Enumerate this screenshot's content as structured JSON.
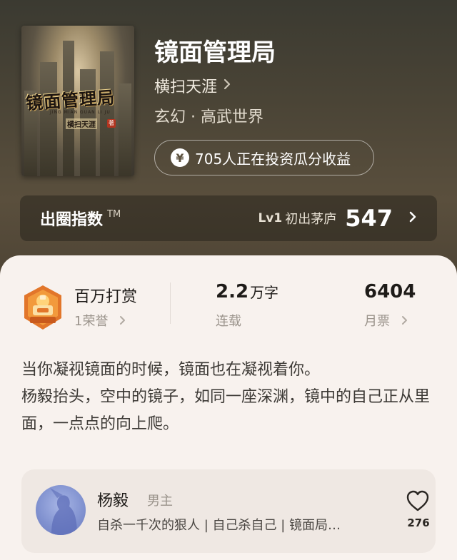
{
  "book": {
    "title": "镜面管理局",
    "author": "横扫天涯",
    "genre": "玄幻 · 高武世界",
    "invest_text": "705人正在投资瓜分收益",
    "cover": {
      "title": "镜面管理局",
      "pinyin": "JING MIAN GUAN LI JU",
      "author": "横扫天涯",
      "badge": "著"
    }
  },
  "index_bar": {
    "label": "出圈指数",
    "tm": "TM",
    "level": "Lv1",
    "level_name": "初出茅庐",
    "score": "547"
  },
  "stats": {
    "reward_title": "百万打赏",
    "reward_sub": "1荣誉",
    "word_count": "2.2",
    "word_unit": "万字",
    "status": "连载",
    "monthly_votes": "6404",
    "monthly_label": "月票"
  },
  "synopsis": [
    "当你凝视镜面的时候，镜面也在凝视着你。",
    "杨毅抬头，空中的镜子，如同一座深渊，镜中的自己正从里面，一点点的向上爬。"
  ],
  "character": {
    "name": "杨毅",
    "role": "男主",
    "tags": "自杀一千次的狠人 | 自己杀自己 | 镜面局…",
    "likes": "276"
  },
  "icons": {
    "chevron": "chevron-right-icon",
    "yen": "yen-coin-icon",
    "heart": "heart-outline-icon",
    "badge": "reward-badge-icon"
  },
  "colors": {
    "header": "#4a4436",
    "sheet": "#f8f2ee",
    "badge_orange": "#e2762a"
  }
}
